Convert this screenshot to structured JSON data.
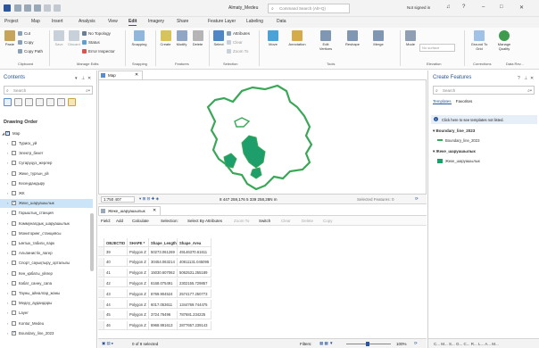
{
  "window": {
    "title": "Almaty_Medeu",
    "search_placeholder": "Command Search (Alt+Q)",
    "signin": "Not signed in"
  },
  "ribbon_tabs": [
    "Project",
    "Map",
    "Insert",
    "Analysis",
    "View",
    "Edit",
    "Imagery",
    "Share",
    "Feature Layer",
    "Labeling",
    "Data"
  ],
  "ribbon": {
    "clipboard": {
      "paste": "Paste",
      "cut": "Cut",
      "copy": "Copy",
      "copy_path": "Copy Path",
      "label": "Clipboard"
    },
    "manage_edits": {
      "save": "Save",
      "discard": "Discard",
      "no_topology": "No Topology",
      "status": "Status",
      "error_inspector": "Error Inspector",
      "label": "Manage Edits"
    },
    "snapping": {
      "btn": "Snapping",
      "label": "Snapping"
    },
    "features": {
      "create": "Create",
      "modify": "Modify",
      "delete": "Delete",
      "label": "Features"
    },
    "selection": {
      "select": "Select",
      "attributes": "Attributes",
      "clear": "Clear",
      "zoom_to": "Zoom To",
      "label": "Selection"
    },
    "tools": {
      "move": "Move",
      "annotation": "Annotation",
      "edit_vertices": "Edit Vertices",
      "reshape": "Reshape",
      "merge": "Merge",
      "label": "Tools"
    },
    "elevation": {
      "mode": "Mode",
      "no_surface": "No surface",
      "label": "Elevation"
    },
    "corrections": {
      "ground_to_grid": "Ground To Grid",
      "manage_quality": "Manage Quality",
      "label": "Corrections",
      "data_reviewer": "Data Rev..."
    }
  },
  "contents": {
    "title": "Contents",
    "search_placeholder": "Search",
    "drawing_order": "Drawing Order",
    "map": "Map",
    "layers": [
      {
        "label": "Туриск_уй",
        "checked": false
      },
      {
        "label": "Электр_бекет",
        "checked": false
      },
      {
        "label": "Сугаруцуз_жерлер",
        "checked": false
      },
      {
        "label": "Жеке_тургын_уй",
        "checked": false
      },
      {
        "label": "Кесеңдандыру",
        "checked": false
      },
      {
        "label": "ЖК",
        "checked": false
      },
      {
        "label": "Жеке_шаруашылык",
        "checked": true,
        "selected": true
      },
      {
        "label": "Гарыштық_станция",
        "checked": false
      },
      {
        "label": "Коммуналдык_шаруашылык",
        "checked": false
      },
      {
        "label": "Мониторинг_станциясы",
        "checked": false
      },
      {
        "label": "Ынтык_табиги_парк",
        "checked": false
      },
      {
        "label": "Альпинистік_лагер",
        "checked": false
      },
      {
        "label": "Спорт_сауықтыру_орталыгы",
        "checked": false
      },
      {
        "label": "Кен_қабаты_уйлер",
        "checked": false
      },
      {
        "label": "Кабат_санну_сапа",
        "checked": false
      },
      {
        "label": "Тауны_айналгар_жаны",
        "checked": false
      },
      {
        "label": "Медеу_аудандары",
        "checked": false
      },
      {
        "label": "Layer",
        "checked": false
      },
      {
        "label": "Kontur_Medeu",
        "checked": false
      },
      {
        "label": "Boundary_line_2023",
        "checked": true
      }
    ]
  },
  "mapview": {
    "tab": "Map",
    "scale": "1:750 407",
    "coords": "8 447 259,176 5 339 258,28N m",
    "selected": "Selected Features: 0"
  },
  "attributes": {
    "tab": "Жеке_шаруашылык",
    "toolbar": {
      "field": "Field:",
      "add": "Add",
      "calculate": "Calculate",
      "selection": "Selection:",
      "select_by_attr": "Select By Attributes",
      "zoom_to": "Zoom To",
      "switch": "Switch",
      "clear": "Clear",
      "delete": "Delete",
      "copy": "Copy"
    },
    "columns": [
      "OBJECTID",
      "SHAPE *",
      "Shape_Length",
      "Shape_Area"
    ],
    "rows": [
      [
        "39",
        "Polygon Z",
        "50273.061269",
        "49146370.61611"
      ],
      [
        "40",
        "Polygon Z",
        "30454.063214",
        "40811131.045095"
      ],
      [
        "41",
        "Polygon Z",
        "15030.607062",
        "5062531.255189"
      ],
      [
        "42",
        "Polygon Z",
        "8168.075491",
        "2302155.729857"
      ],
      [
        "43",
        "Polygon Z",
        "8769.904524",
        "2574177.250773"
      ],
      [
        "44",
        "Polygon Z",
        "6017.053611",
        "1344769.744475"
      ],
      [
        "45",
        "Polygon Z",
        "3724.76496",
        "787681.234225"
      ],
      [
        "46",
        "Polygon Z",
        "8968.991613",
        "2877657.239143"
      ]
    ],
    "status": "0 of 8 selected",
    "filters": "Filters:",
    "zoom_pct": "100%"
  },
  "create_features": {
    "title": "Create Features",
    "search_placeholder": "Search",
    "tabs": [
      "Templates",
      "Favorites"
    ],
    "tip": "Click here to see templates not listed.",
    "groups": [
      {
        "name": "Boundary_line_2023",
        "template": "Boundary_line_2023",
        "color": "#3aa757",
        "kind": "line"
      },
      {
        "name": "Жеке_шаруашылык",
        "template": "Жеке_шаруашылык",
        "color": "#1e9e6a",
        "kind": "fill"
      }
    ]
  },
  "bottom_tabs": "C... M... S... G... C... R... L... A... M..."
}
